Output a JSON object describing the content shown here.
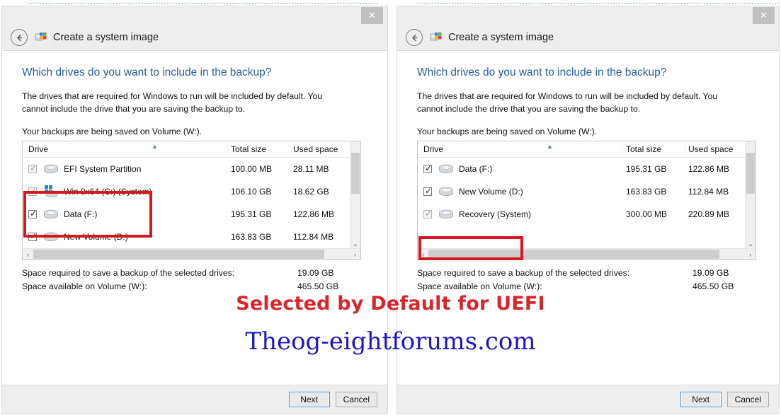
{
  "window": {
    "title": "Create a system image",
    "close_label": "✕",
    "back_icon": "back-arrow-icon",
    "app_icon": "system-image-icon"
  },
  "content": {
    "question": "Which drives do you want to include in the backup?",
    "description": "The drives that are required for Windows to run will be included by default. You cannot include the drive that you are saving the backup to.",
    "saved_on": "Your backups are being saved on Volume (W:).",
    "columns": {
      "drive": "Drive",
      "total_size": "Total size",
      "used_space": "Used space"
    },
    "summary": {
      "required_label": "Space required to save a backup of the selected drives:",
      "required_value": "19.09 GB",
      "available_label": "Space available on Volume (W:):",
      "available_value": "465.50 GB"
    }
  },
  "left_panel": {
    "rows": [
      {
        "name": "EFI System Partition",
        "total_size": "100.00 MB",
        "used_space": "28.11 MB",
        "checked": true,
        "disabled": true,
        "icon": "hard-drive-icon"
      },
      {
        "name": "Win 8x64 (C:) (System)",
        "total_size": "106.10 GB",
        "used_space": "18.62 GB",
        "checked": true,
        "disabled": true,
        "icon": "windows-drive-icon"
      },
      {
        "name": "Data (F:)",
        "total_size": "195.31 GB",
        "used_space": "122.86 MB",
        "checked": true,
        "disabled": false,
        "icon": "hard-drive-icon"
      },
      {
        "name": "New Volume (D:)",
        "total_size": "163.83 GB",
        "used_space": "112.84 MB",
        "checked": true,
        "disabled": false,
        "icon": "hard-drive-icon"
      }
    ]
  },
  "right_panel": {
    "rows": [
      {
        "name": "Data (F:)",
        "total_size": "195.31 GB",
        "used_space": "122.86 MB",
        "checked": true,
        "disabled": false,
        "icon": "hard-drive-icon"
      },
      {
        "name": "New Volume (D:)",
        "total_size": "163.83 GB",
        "used_space": "112.84 MB",
        "checked": true,
        "disabled": false,
        "icon": "hard-drive-icon"
      },
      {
        "name": "Recovery (System)",
        "total_size": "300.00 MB",
        "used_space": "220.89 MB",
        "checked": true,
        "disabled": true,
        "icon": "hard-drive-icon"
      }
    ]
  },
  "footer": {
    "next_label": "Next",
    "cancel_label": "Cancel"
  },
  "annotations": {
    "red_text": "Selected by Default for UEFI",
    "blue_text": "Theog-eightforums.com",
    "red_color": "#d9262c",
    "blue_color": "#1f15c4",
    "highlight_color": "#d6171d"
  }
}
